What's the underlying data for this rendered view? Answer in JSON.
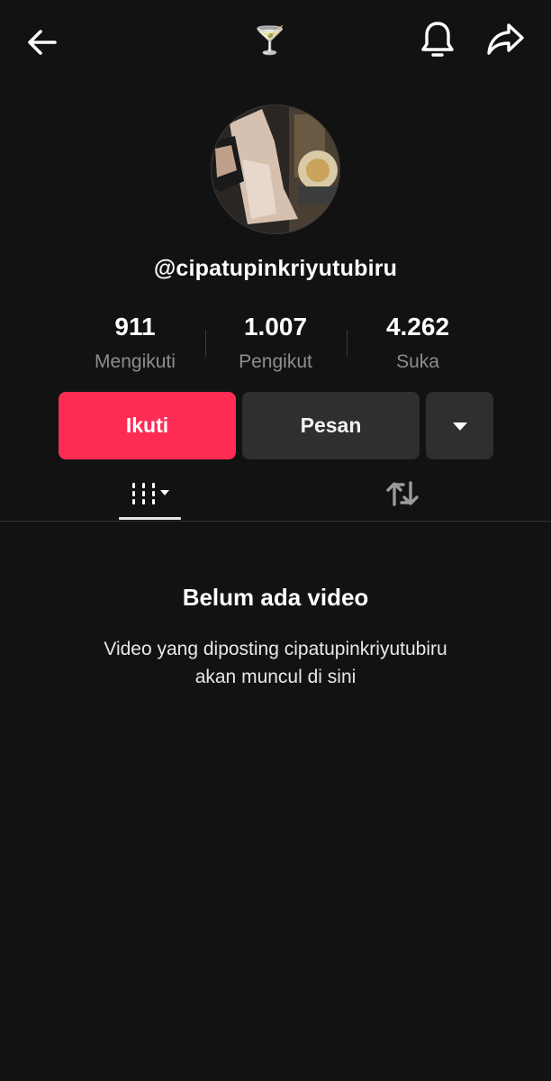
{
  "header": {
    "title_emoji": "🍸",
    "icons": [
      "back-arrow-icon",
      "bell-icon",
      "share-icon"
    ]
  },
  "profile": {
    "username": "@cipatupinkriyutubiru"
  },
  "stats": [
    {
      "value": "911",
      "label": "Mengikuti"
    },
    {
      "value": "1.007",
      "label": "Pengikut"
    },
    {
      "value": "4.262",
      "label": "Suka"
    }
  ],
  "actions": {
    "follow_label": "Ikuti",
    "message_label": "Pesan"
  },
  "tabs": {
    "active": "videos",
    "items": [
      "videos-grid-icon",
      "repost-icon"
    ]
  },
  "empty_state": {
    "title": "Belum ada video",
    "line1": "Video yang diposting cipatupinkriyutubiru",
    "line2": "akan muncul di sini"
  },
  "colors": {
    "background": "#121212",
    "accent": "#fe2c55",
    "secondary_button": "#2f2f2f",
    "muted_text": "#8e8e8e"
  }
}
